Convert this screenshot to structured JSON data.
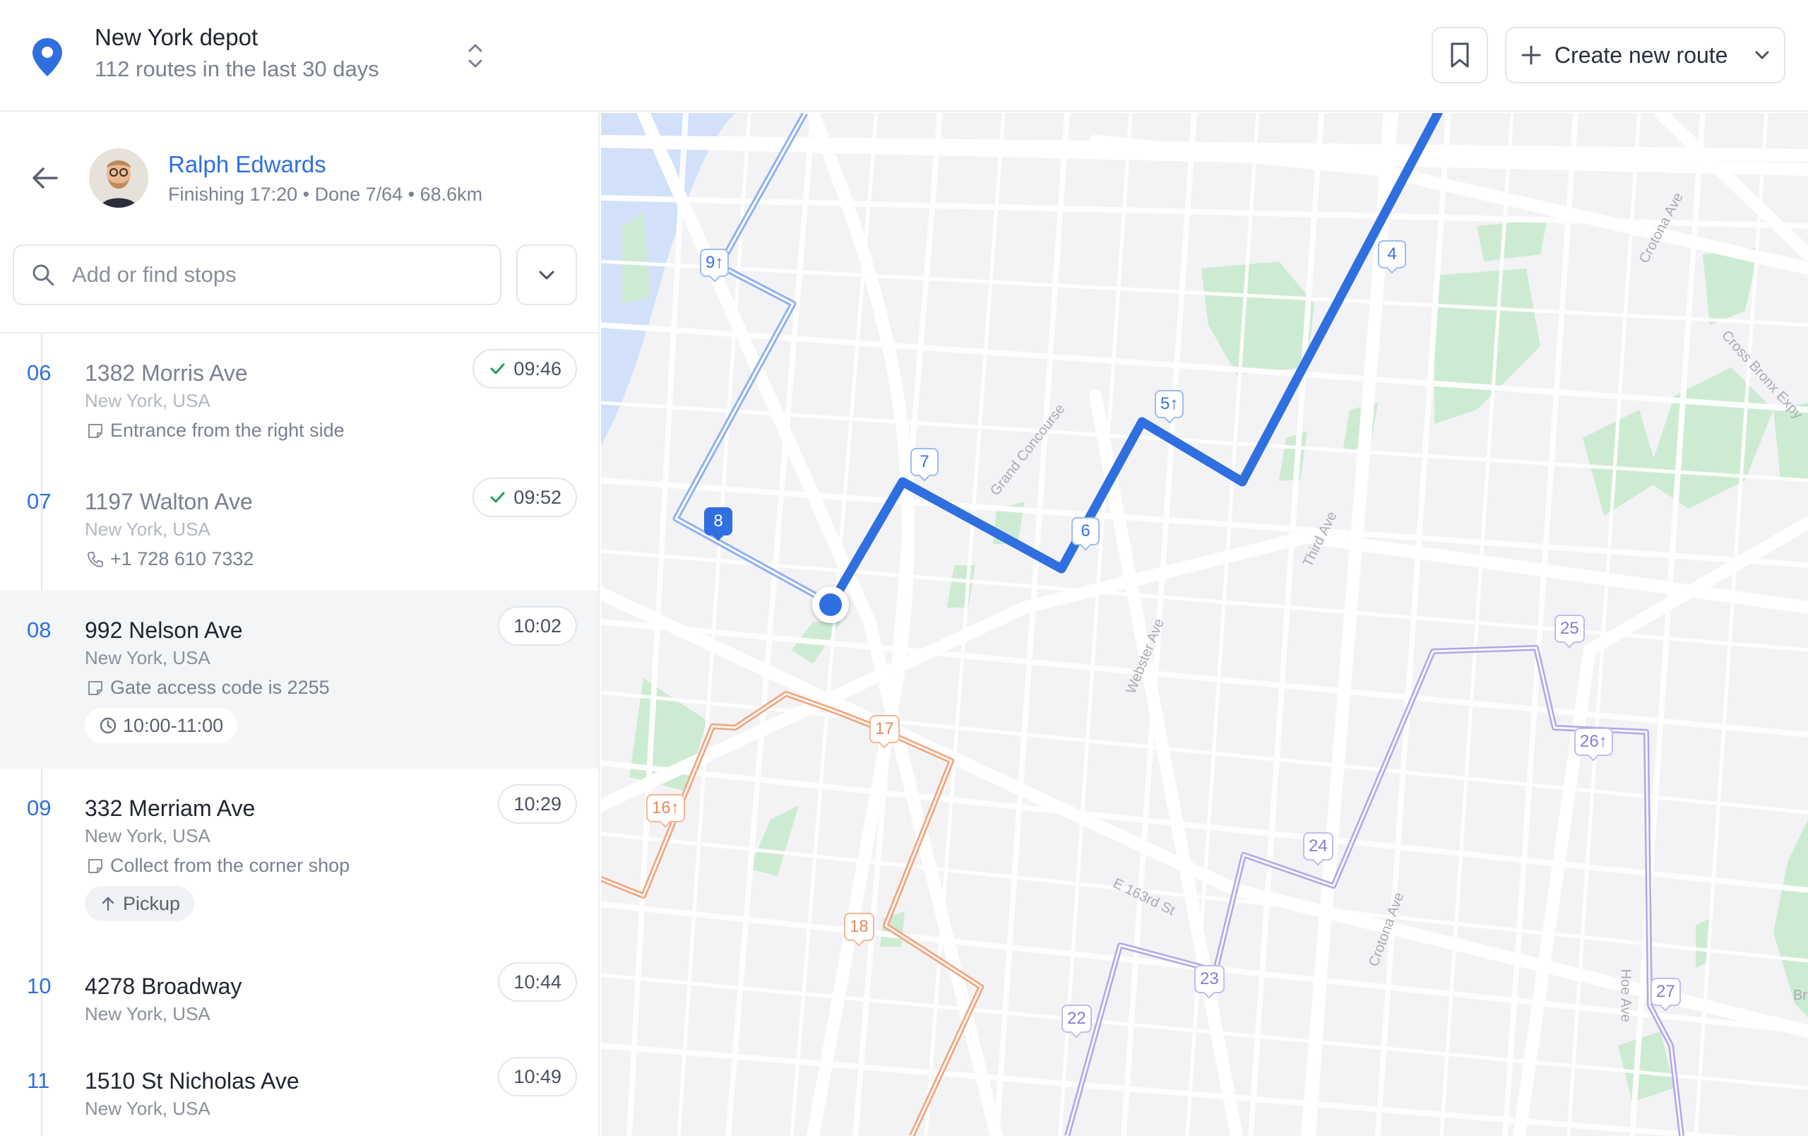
{
  "header": {
    "depot_title": "New York depot",
    "depot_subtitle": "112 routes in the last 30 days",
    "create_route_label": "Create new route"
  },
  "driver": {
    "name": "Ralph Edwards",
    "meta": "Finishing 17:20 • Done 7/64 • 68.6km"
  },
  "search": {
    "placeholder": "Add or find stops"
  },
  "stops": [
    {
      "number": "06",
      "address": "1382 Morris Ave",
      "city": "New York, USA",
      "note": "Entrance from the right side",
      "time": "09:46",
      "status": "done"
    },
    {
      "number": "07",
      "address": "1197 Walton Ave",
      "city": "New York, USA",
      "note": "+1 728 610 7332",
      "time": "09:52",
      "status": "done"
    },
    {
      "number": "08",
      "address": "992 Nelson Ave",
      "city": "New York, USA",
      "note": "Gate access code is 2255",
      "time": "10:02",
      "window": "10:00-11:00",
      "status": "current"
    },
    {
      "number": "09",
      "address": "332 Merriam Ave",
      "city": "New York, USA",
      "note": "Collect from the corner shop",
      "time": "10:29",
      "tag": "Pickup",
      "status": "upcoming"
    },
    {
      "number": "10",
      "address": "4278 Broadway",
      "city": "New York, USA",
      "time": "10:44",
      "status": "upcoming"
    },
    {
      "number": "11",
      "address": "1510 St Nicholas Ave",
      "city": "New York, USA",
      "time": "10:49",
      "status": "upcoming"
    }
  ],
  "map": {
    "street_labels": [
      "Grand Concourse",
      "Third Ave",
      "Webster Ave",
      "E 163rd St",
      "Crotona Ave",
      "Crotona Ave",
      "Cross Bronx Expy",
      "Hoe Ave",
      "Bri"
    ],
    "markers": {
      "blue": [
        "9↑",
        "8",
        "7",
        "6",
        "5↑",
        "4"
      ],
      "orange": [
        "16↑",
        "17",
        "18"
      ],
      "purple": [
        "22",
        "23",
        "24",
        "25",
        "26↑",
        "27"
      ]
    },
    "colors": {
      "route_blue": "#2f6fe0",
      "route_orange": "#f2a27a",
      "route_purple": "#b3a5ec",
      "park_green": "#cdebd2",
      "water_blue": "#d3e0fa"
    }
  }
}
